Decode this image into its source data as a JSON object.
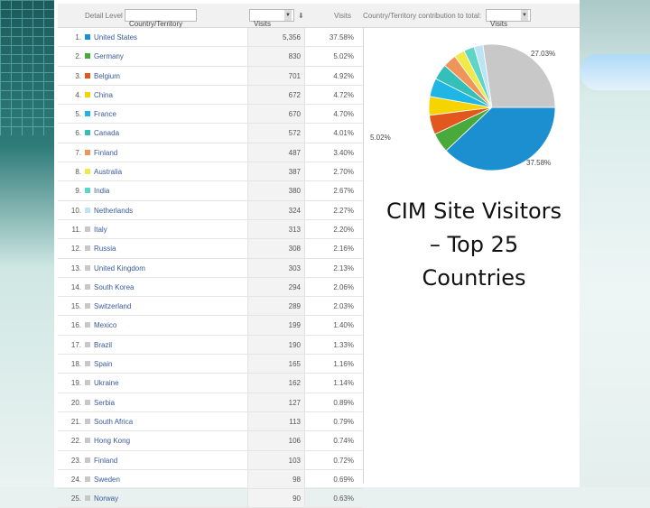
{
  "header": {
    "detail_level_label": "Detail Level",
    "detail_level_value": "Country/Territory",
    "metric_select": "Visits",
    "visits_col": "Visits",
    "contribution_label": "Country/Territory contribution to total:",
    "contribution_select": "Visits"
  },
  "rows": [
    {
      "idx": "1.",
      "country": "United States",
      "visits": "5,356",
      "pct": "37.58%",
      "color": "#1b8fcf"
    },
    {
      "idx": "2.",
      "country": "Germany",
      "visits": "830",
      "pct": "5.02%",
      "color": "#4aa93b"
    },
    {
      "idx": "3.",
      "country": "Belgium",
      "visits": "701",
      "pct": "4.92%",
      "color": "#e2571e"
    },
    {
      "idx": "4.",
      "country": "China",
      "visits": "672",
      "pct": "4.72%",
      "color": "#f5d400"
    },
    {
      "idx": "5.",
      "country": "France",
      "visits": "670",
      "pct": "4.70%",
      "color": "#1fb6e6"
    },
    {
      "idx": "6.",
      "country": "Canada",
      "visits": "572",
      "pct": "4.01%",
      "color": "#34c0b8"
    },
    {
      "idx": "7.",
      "country": "Finland",
      "visits": "487",
      "pct": "3.40%",
      "color": "#f0955a"
    },
    {
      "idx": "8.",
      "country": "Australia",
      "visits": "387",
      "pct": "2.70%",
      "color": "#f1e84a"
    },
    {
      "idx": "9.",
      "country": "India",
      "visits": "380",
      "pct": "2.67%",
      "color": "#5fd5c6"
    },
    {
      "idx": "10.",
      "country": "Netherlands",
      "visits": "324",
      "pct": "2.27%",
      "color": "#bde3f7"
    },
    {
      "idx": "11.",
      "country": "Italy",
      "visits": "313",
      "pct": "2.20%",
      "color": "#c8c8c8"
    },
    {
      "idx": "12.",
      "country": "Russia",
      "visits": "308",
      "pct": "2.16%",
      "color": "#c8c8c8"
    },
    {
      "idx": "13.",
      "country": "United Kingdom",
      "visits": "303",
      "pct": "2.13%",
      "color": "#c8c8c8"
    },
    {
      "idx": "14.",
      "country": "South Korea",
      "visits": "294",
      "pct": "2.06%",
      "color": "#c8c8c8"
    },
    {
      "idx": "15.",
      "country": "Switzerland",
      "visits": "289",
      "pct": "2.03%",
      "color": "#c8c8c8"
    },
    {
      "idx": "16.",
      "country": "Mexico",
      "visits": "199",
      "pct": "1.40%",
      "color": "#c8c8c8"
    },
    {
      "idx": "17.",
      "country": "Brazil",
      "visits": "190",
      "pct": "1.33%",
      "color": "#c8c8c8"
    },
    {
      "idx": "18.",
      "country": "Spain",
      "visits": "165",
      "pct": "1.16%",
      "color": "#c8c8c8"
    },
    {
      "idx": "19.",
      "country": "Ukraine",
      "visits": "162",
      "pct": "1.14%",
      "color": "#c8c8c8"
    },
    {
      "idx": "20.",
      "country": "Serbia",
      "visits": "127",
      "pct": "0.89%",
      "color": "#c8c8c8"
    },
    {
      "idx": "21.",
      "country": "South Africa",
      "visits": "113",
      "pct": "0.79%",
      "color": "#c8c8c8"
    },
    {
      "idx": "22.",
      "country": "Hong Kong",
      "visits": "106",
      "pct": "0.74%",
      "color": "#c8c8c8"
    },
    {
      "idx": "23.",
      "country": "Finland",
      "visits": "103",
      "pct": "0.72%",
      "color": "#c8c8c8"
    },
    {
      "idx": "24.",
      "country": "Sweden",
      "visits": "98",
      "pct": "0.69%",
      "color": "#c8c8c8"
    },
    {
      "idx": "25.",
      "country": "Norway",
      "visits": "90",
      "pct": "0.63%",
      "color": "#c8c8c8"
    }
  ],
  "chart_data": {
    "type": "pie",
    "slices": [
      {
        "label": "United States",
        "value": 37.58,
        "color": "#1b8fcf"
      },
      {
        "label": "Germany",
        "value": 5.02,
        "color": "#4aa93b"
      },
      {
        "label": "Belgium",
        "value": 4.92,
        "color": "#e2571e"
      },
      {
        "label": "China",
        "value": 4.72,
        "color": "#f5d400"
      },
      {
        "label": "France",
        "value": 4.7,
        "color": "#1fb6e6"
      },
      {
        "label": "Canada",
        "value": 4.01,
        "color": "#34c0b8"
      },
      {
        "label": "Finland",
        "value": 3.4,
        "color": "#f0955a"
      },
      {
        "label": "Australia",
        "value": 2.7,
        "color": "#f1e84a"
      },
      {
        "label": "India",
        "value": 2.67,
        "color": "#5fd5c6"
      },
      {
        "label": "Netherlands",
        "value": 2.27,
        "color": "#bde3f7"
      },
      {
        "label": "Other",
        "value": 27.03,
        "color": "#c8c8c8"
      }
    ],
    "data_labels": [
      "27.03%",
      "5.02%",
      "37.58%"
    ]
  },
  "slide_title_lines": [
    "CIM Site Visitors",
    "– Top 25",
    "Countries"
  ]
}
